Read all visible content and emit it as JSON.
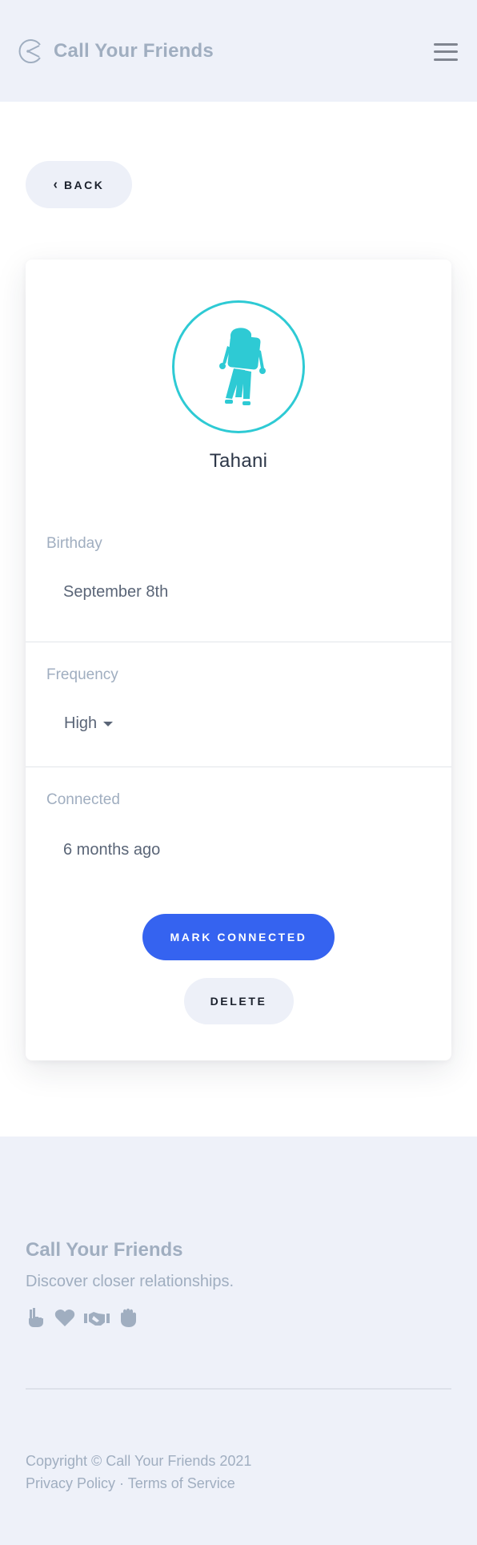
{
  "header": {
    "app_name": "Call Your Friends",
    "logo_icon": "phone-dial-icon",
    "menu_icon": "hamburger-menu-icon"
  },
  "navigation": {
    "back_label": "BACK",
    "back_icon": "chevron-left-icon"
  },
  "friend": {
    "name": "Tahani",
    "avatar_icon": "astronaut-icon",
    "avatar_color": "#2ecad4",
    "fields": {
      "birthday": {
        "label": "Birthday",
        "value": "September 8th"
      },
      "frequency": {
        "label": "Frequency",
        "value": "High"
      },
      "connected": {
        "label": "Connected",
        "value": "6 months ago"
      }
    }
  },
  "actions": {
    "mark_connected_label": "MARK CONNECTED",
    "delete_label": "DELETE",
    "primary_color": "#3563f0"
  },
  "footer": {
    "brand": "Call Your Friends",
    "tagline": "Discover closer relationships.",
    "icons": [
      "peace-hand-icon",
      "heart-icon",
      "handshake-icon",
      "fist-icon"
    ],
    "copyright": "Copyright © Call Your Friends 2021",
    "privacy_label": "Privacy Policy",
    "separator": " · ",
    "terms_label": "Terms of Service"
  }
}
